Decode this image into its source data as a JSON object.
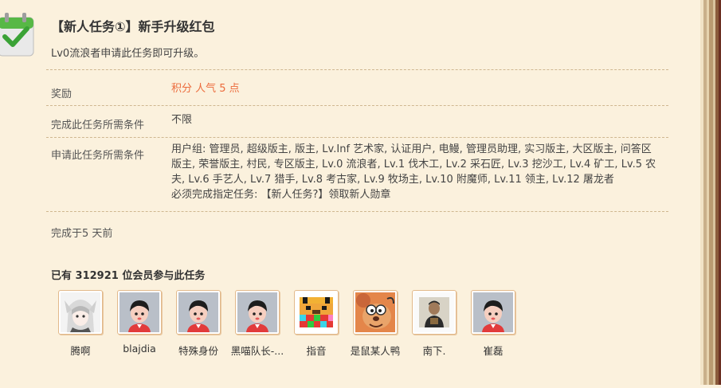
{
  "task": {
    "title": "【新人任务①】新手升级红包",
    "description": "Lv0流浪者申请此任务即可升级。"
  },
  "rows": {
    "reward_label": "奖励",
    "reward_value": "积分 人气 5 点",
    "complete_label": "完成此任务所需条件",
    "complete_value": "不限",
    "apply_label": "申请此任务所需条件",
    "apply_value_line1": "用户组: 管理员, 超级版主, 版主, Lv.Inf 艺术家, 认证用户, 电鳗, 管理员助理, 实习版主, 大区版主, 问答区",
    "apply_value_line2": "版主, 荣誉版主, 村民, 专区版主, Lv.0 流浪者, Lv.1 伐木工, Lv.2 采石匠, Lv.3 挖沙工, Lv.4 矿工, Lv.5 农",
    "apply_value_line3": "夫, Lv.6 手艺人, Lv.7 猎手, Lv.8 考古家, Lv.9 牧场主, Lv.10 附魔师, Lv.11 领主, Lv.12 屠龙者",
    "apply_value_line4": "必须完成指定任务: 【新人任务?】领取新人勋章"
  },
  "completed_time": "完成于5 天前",
  "participants": {
    "title": "已有 312921 位会员参与此任务",
    "members": [
      {
        "name": "腾啊",
        "icon": "anime-girl-avatar"
      },
      {
        "name": "blajdia",
        "icon": "default-avatar"
      },
      {
        "name": "特殊身份",
        "icon": "default-avatar"
      },
      {
        "name": "黑喵队长-...",
        "icon": "default-avatar"
      },
      {
        "name": "指音",
        "icon": "pixel-bear-avatar"
      },
      {
        "name": "是鼠某人鸭",
        "icon": "cartoon-mouse-avatar"
      },
      {
        "name": "南下.",
        "icon": "child-photo-avatar"
      },
      {
        "name": "崔磊",
        "icon": "default-avatar"
      }
    ]
  },
  "colors": {
    "background": "#fbf1dd",
    "reward": "#ec6b3c",
    "divider": "#cfb790",
    "icon_check": "#4db84a"
  }
}
